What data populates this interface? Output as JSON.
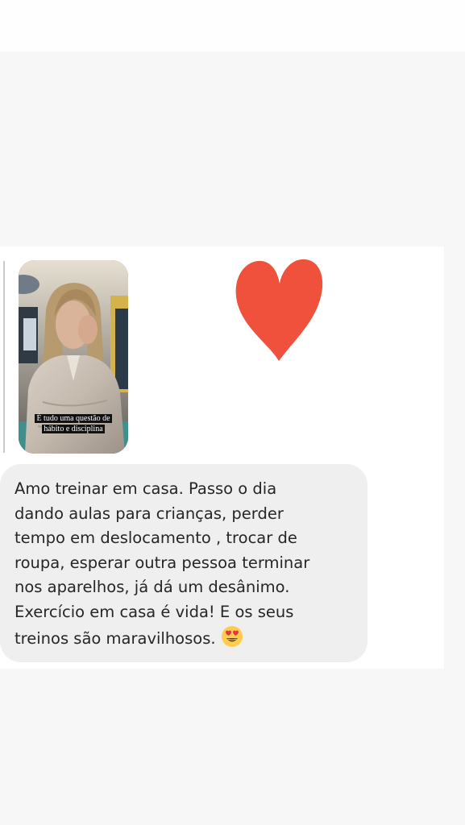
{
  "story": {
    "caption_line1": "É tudo uma questão de",
    "caption_line2": "hábito e disciplina"
  },
  "reaction": {
    "icon": "heart-icon",
    "color": "#f0513c"
  },
  "message": {
    "text": "Amo treinar em casa. Passo o dia\ndando aulas para crianças, perder\ntempo em deslocamento , trocar de\nroupa, esperar outra pessoa terminar\nnos aparelhos, já dá um desânimo.\nExercício em casa é vida! E os seus\ntreinos são maravilhosos.",
    "emoji": "heart-eyes-emoji",
    "bubble_color": "#efefef"
  }
}
